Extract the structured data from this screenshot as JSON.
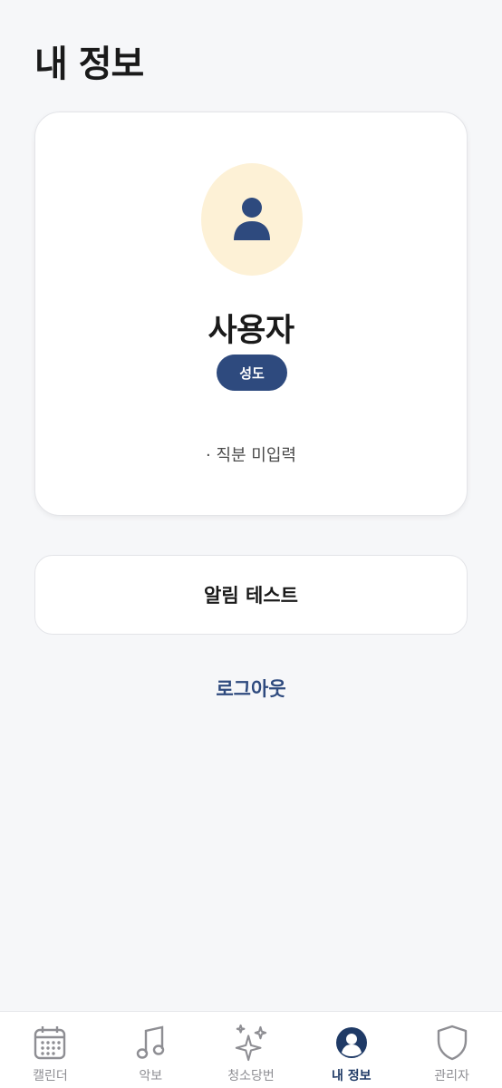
{
  "header": {
    "title": "내 정보"
  },
  "profile": {
    "avatar_icon": "user-icon",
    "name": "사용자",
    "role": "성도",
    "position": "· 직분 미입력"
  },
  "actions": {
    "notify_test_label": "알림 테스트",
    "logout_label": "로그아웃"
  },
  "tabs": [
    {
      "label": "캘린더",
      "icon": "calendar-icon",
      "active": false
    },
    {
      "label": "악보",
      "icon": "music-note-icon",
      "active": false
    },
    {
      "label": "청소당번",
      "icon": "sparkles-icon",
      "active": false
    },
    {
      "label": "내 정보",
      "icon": "profile-icon",
      "active": true
    },
    {
      "label": "관리자",
      "icon": "shield-icon",
      "active": false
    }
  ],
  "colors": {
    "accent": "#2e4a7e",
    "avatar_bg": "#fdf1d6",
    "background": "#f6f7f9",
    "inactive_tab": "#8e8e93"
  }
}
